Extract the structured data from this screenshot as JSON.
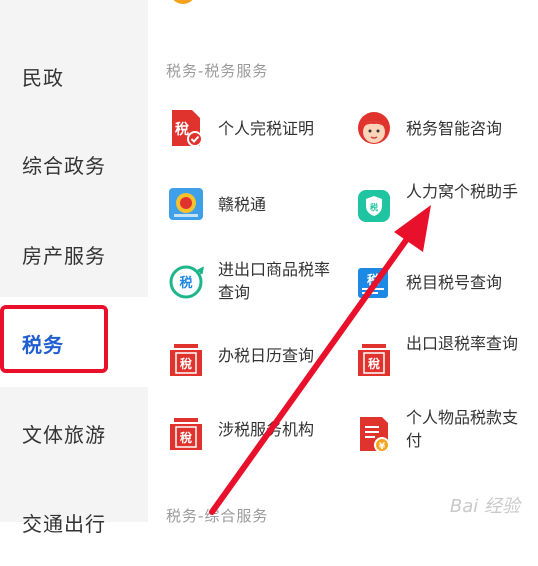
{
  "sidebar": {
    "items": [
      {
        "label": "民政"
      },
      {
        "label": "综合政务"
      },
      {
        "label": "房产服务"
      },
      {
        "label": "税务"
      },
      {
        "label": "文体旅游"
      },
      {
        "label": "交通出行"
      }
    ]
  },
  "sections": [
    {
      "title": "税务-税务服务",
      "services": [
        {
          "label": "个人完税证明",
          "icon": "tax-certificate-icon"
        },
        {
          "label": "税务智能咨询",
          "icon": "tax-assistant-avatar-icon"
        },
        {
          "label": "赣税通",
          "icon": "gan-tax-icon"
        },
        {
          "label": "人力窝个税助手",
          "icon": "tax-shield-icon"
        },
        {
          "label": "进出口商品税率查询",
          "icon": "import-export-tax-icon"
        },
        {
          "label": "税目税号查询",
          "icon": "tax-code-icon"
        },
        {
          "label": "办税日历查询",
          "icon": "tax-calendar-icon"
        },
        {
          "label": "出口退税率查询",
          "icon": "export-refund-icon"
        },
        {
          "label": "涉税服务机构",
          "icon": "tax-agency-icon"
        },
        {
          "label": "个人物品税款支付",
          "icon": "personal-goods-tax-icon"
        }
      ]
    },
    {
      "title": "税务-综合服务"
    }
  ],
  "watermark": "Bai 经验",
  "colors": {
    "active_sidebar_text": "#1f5fd1",
    "highlight_red": "#e8102a",
    "tax_red": "#e0332e",
    "teal": "#1fc4a0",
    "blue": "#1e88e5"
  }
}
